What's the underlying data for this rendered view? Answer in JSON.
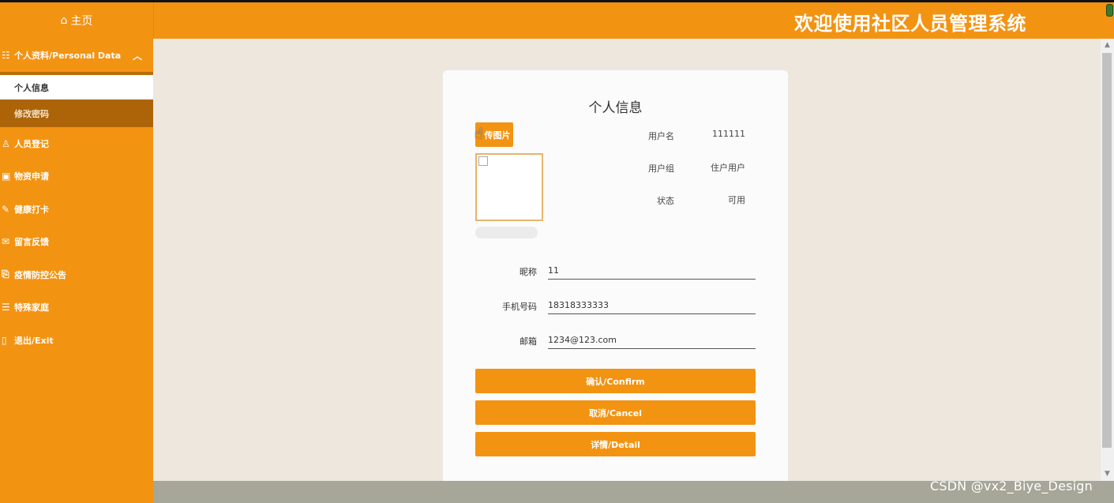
{
  "header": {
    "home_label": "主页",
    "title": "欢迎使用社区人员管理系统"
  },
  "sidebar": {
    "group_label": "个人资料/Personal Data",
    "sub_items": [
      {
        "label": "个人信息",
        "active": true
      },
      {
        "label": "修改密码",
        "active": false
      }
    ],
    "items": [
      {
        "label": "人员登记",
        "icon": "person-icon"
      },
      {
        "label": "物资申请",
        "icon": "box-icon"
      },
      {
        "label": "健康打卡",
        "icon": "pen-icon"
      },
      {
        "label": "留言反馈",
        "icon": "feedback-icon"
      },
      {
        "label": "疫情防控公告",
        "icon": "notice-icon"
      },
      {
        "label": "特殊家庭",
        "icon": "list-icon"
      },
      {
        "label": "退出/Exit",
        "icon": "exit-icon"
      }
    ]
  },
  "card": {
    "title": "个人信息",
    "upload_label": "传图片",
    "info": [
      {
        "label": "用户名",
        "value": "111111"
      },
      {
        "label": "用户组",
        "value": "住户用户"
      },
      {
        "label": "状态",
        "value": "可用"
      }
    ],
    "fields": [
      {
        "label": "昵称",
        "value": "11"
      },
      {
        "label": "手机号码",
        "value": "18318333333"
      },
      {
        "label": "邮箱",
        "value": "1234@123.com"
      }
    ],
    "buttons": {
      "confirm": "确认/Confirm",
      "cancel": "取消/Cancel",
      "detail": "详情/Detail"
    }
  },
  "watermark": "CSDN @vx2_Biye_Design",
  "colors": {
    "accent": "#f39312",
    "accent_dark": "#ad6409",
    "background": "#ede7de"
  }
}
